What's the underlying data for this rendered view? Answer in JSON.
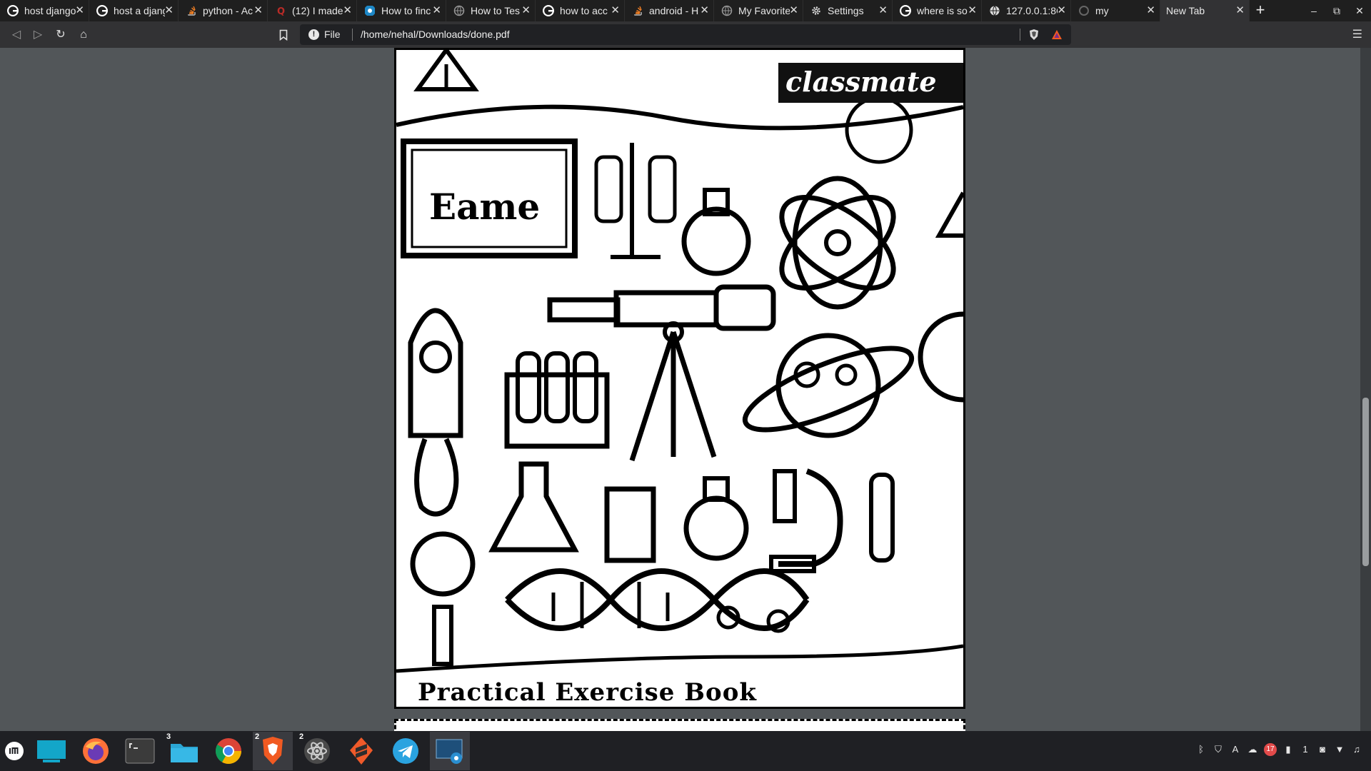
{
  "tabs": [
    {
      "title": "host django",
      "icon": "google-icon",
      "active": false
    },
    {
      "title": "host a djang",
      "icon": "google-icon",
      "active": false
    },
    {
      "title": "python - Ac",
      "icon": "stackoverflow-icon",
      "active": false
    },
    {
      "title": "(12) I made",
      "icon": "quora-icon",
      "active": false
    },
    {
      "title": "How to finc",
      "icon": "blue-site-icon",
      "active": false
    },
    {
      "title": "How to Tes",
      "icon": "globe-icon",
      "active": false
    },
    {
      "title": "how to acc",
      "icon": "google-icon",
      "active": false
    },
    {
      "title": "android - H",
      "icon": "stackoverflow-icon",
      "active": false
    },
    {
      "title": "My Favorite",
      "icon": "globe-icon",
      "active": false
    },
    {
      "title": "Settings",
      "icon": "gear-icon",
      "active": false
    },
    {
      "title": "where is so",
      "icon": "google-icon",
      "active": false
    },
    {
      "title": "127.0.0.1:8C",
      "icon": "globe-icon",
      "active": false
    },
    {
      "title": "my",
      "icon": "loading-icon",
      "active": false
    },
    {
      "title": "New Tab",
      "icon": "",
      "active": true
    }
  ],
  "new_tab_label": "+",
  "window_controls": {
    "minimize": "–",
    "restore": "⧉",
    "close": "✕"
  },
  "address": {
    "scheme": "File",
    "url": "/home/nehal/Downloads/done.pdf"
  },
  "pdf": {
    "brand": "classmate",
    "board_text": "Eame",
    "cover_title": "Practical Exercise Book"
  },
  "taskbar": {
    "apps": [
      {
        "name": "menu-icon",
        "badge": ""
      },
      {
        "name": "show-desktop-icon",
        "badge": ""
      },
      {
        "name": "firefox-icon",
        "badge": ""
      },
      {
        "name": "terminal-icon",
        "badge": ""
      },
      {
        "name": "files-icon",
        "badge": "3"
      },
      {
        "name": "chrome-icon",
        "badge": ""
      },
      {
        "name": "brave-icon",
        "badge": "2"
      },
      {
        "name": "atom-icon",
        "badge": "2"
      },
      {
        "name": "sublime-icon",
        "badge": ""
      },
      {
        "name": "telegram-icon",
        "badge": ""
      },
      {
        "name": "screenshot-icon",
        "badge": ""
      }
    ],
    "tray_notification_count": "17",
    "tray_workspace": "1"
  },
  "colors": {
    "tabbar": "#1f1f1f",
    "toolbar": "#323234",
    "viewer_bg": "#525659",
    "taskbar": "#1f2024",
    "accent_orange": "#f15a22"
  }
}
